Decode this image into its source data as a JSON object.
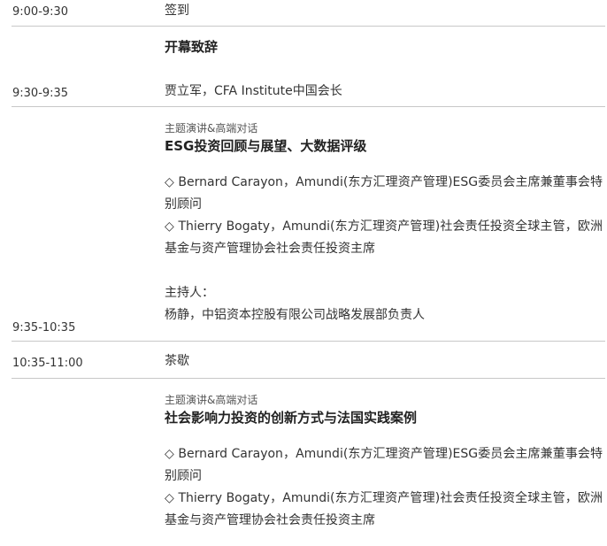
{
  "rows": [
    {
      "time": "9:00-9:30",
      "text": "签到"
    },
    {
      "time": "9:30-9:35",
      "title": "开幕致辞",
      "speaker": "贾立军，CFA Institute中国会长"
    },
    {
      "time": "9:35-10:35",
      "category": "主题演讲&高端对话",
      "title": "ESG投资回顾与展望、大数据评级",
      "speakers": [
        "◇ Bernard Carayon，Amundi(东方汇理资产管理)ESG委员会主席兼董事会特别顾问",
        "◇ Thierry Bogaty，Amundi(东方汇理资产管理)社会责任投资全球主管，欧洲基金与资产管理协会社会责任投资主席"
      ],
      "host_label": "主持人：",
      "host": "杨静，中铝资本控股有限公司战略发展部负责人"
    },
    {
      "time": "10:35-11:00",
      "text": "茶歇"
    },
    {
      "category": "主题演讲&高端对话",
      "title": "社会影响力投资的创新方式与法国实践案例",
      "speakers": [
        "◇ Bernard Carayon，Amundi(东方汇理资产管理)ESG委员会主席兼董事会特别顾问",
        "◇ Thierry Bogaty，Amundi(东方汇理资产管理)社会责任投资全球主管，欧洲基金与资产管理协会社会责任投资主席"
      ]
    }
  ]
}
